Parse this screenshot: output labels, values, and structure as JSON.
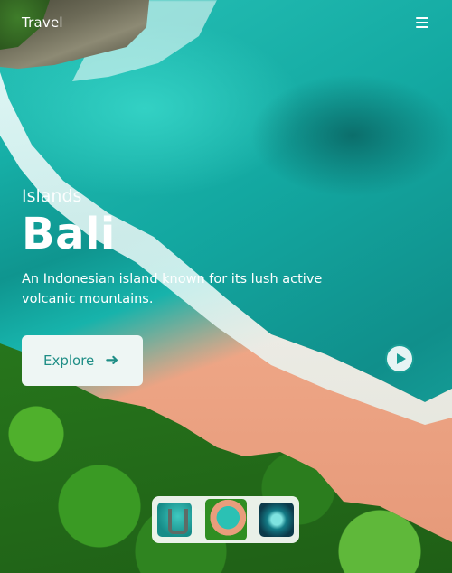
{
  "navbar": {
    "brand": "Travel"
  },
  "hero": {
    "subtitle": "Islands",
    "title": "Bali",
    "description": "An Indonesian island known for its lush active volcanic mountains.",
    "explore_label": "Explore"
  },
  "colors": {
    "accent": "#1a9d95",
    "button_bg": "#eef6f4"
  },
  "icons": {
    "menu": "hamburger-menu-icon",
    "arrow": "arrow-right-icon",
    "play": "play-circle-icon"
  }
}
